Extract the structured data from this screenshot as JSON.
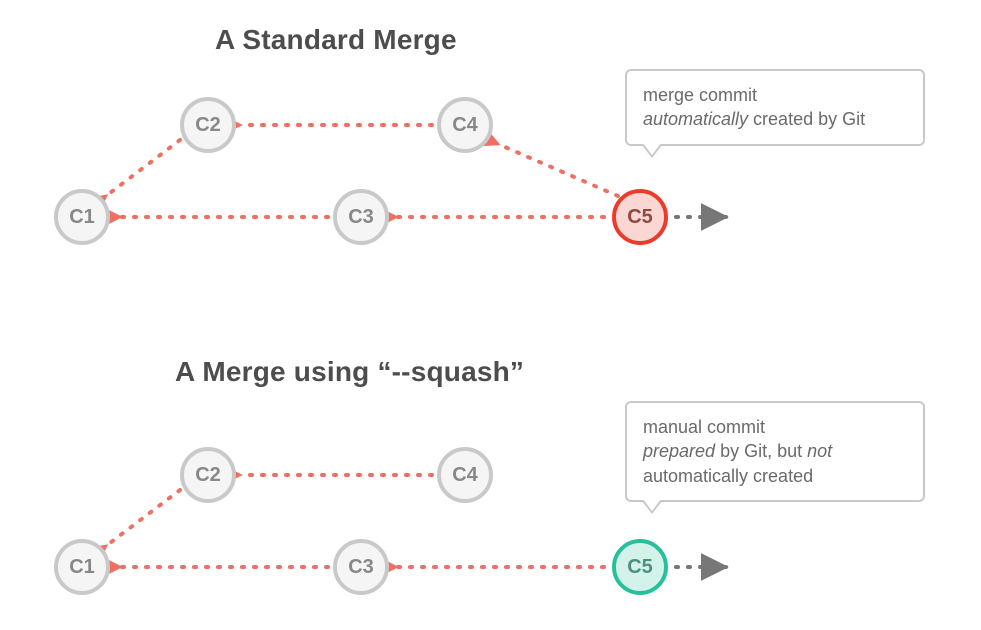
{
  "titles": {
    "standard": "A Standard Merge",
    "squash": "A Merge using “--squash”"
  },
  "commits": {
    "c1": "C1",
    "c2": "C2",
    "c3": "C3",
    "c4": "C4",
    "c5": "C5"
  },
  "callouts": {
    "standard": {
      "line1": "merge commit",
      "line2_em": "automatically",
      "line2_rest": " created by Git"
    },
    "squash": {
      "line1": "manual commit",
      "line2_em1": "prepared",
      "line2_mid": " by Git, but ",
      "line2_em2": "not",
      "line3": "automatically created"
    }
  },
  "colors": {
    "dotted": "#ef6f63",
    "gray_arrow": "#777777"
  }
}
